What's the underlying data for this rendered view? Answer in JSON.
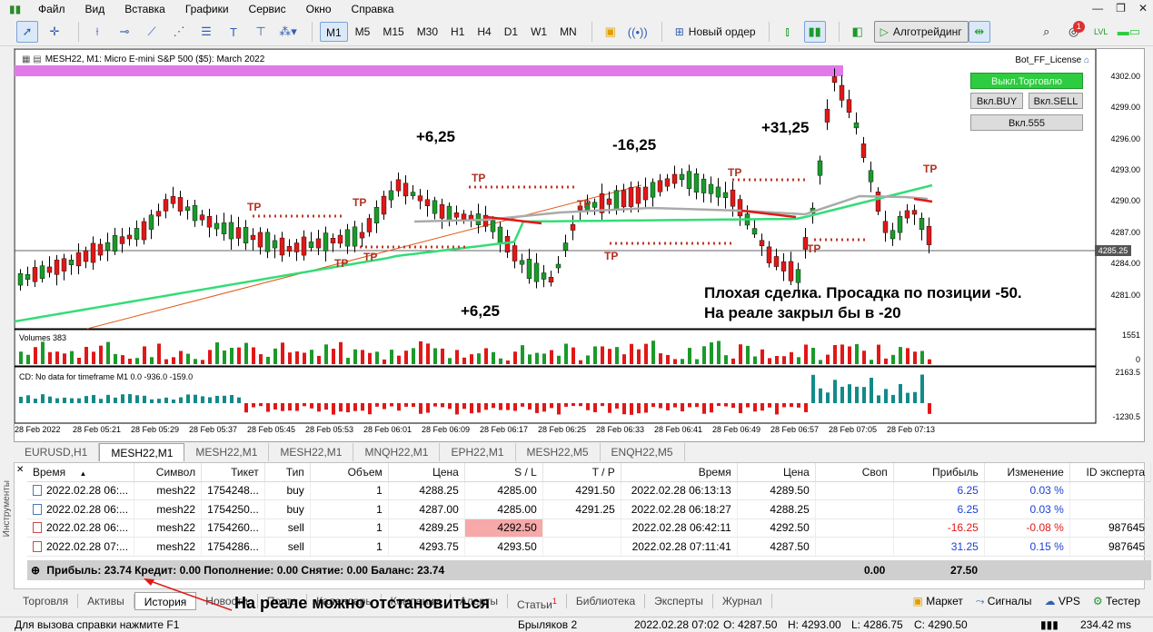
{
  "menu": [
    "Файл",
    "Вид",
    "Вставка",
    "Графики",
    "Сервис",
    "Окно",
    "Справка"
  ],
  "window_controls": [
    "—",
    "❐",
    "✕"
  ],
  "toolbar": {
    "timeframes": [
      "M1",
      "M5",
      "M15",
      "M30",
      "H1",
      "H4",
      "D1",
      "W1",
      "MN"
    ],
    "active_timeframe": "M1",
    "new_order": "Новый ордер",
    "algotrading": "Алготрейдинг",
    "notification_count": "1"
  },
  "chart": {
    "title": "MESH22, M1:  Micro E-mini S&P 500 ($5): March 2022",
    "bot_label": "Bot_FF_License",
    "buttons": {
      "trade_off": "Выкл.Торговлю",
      "buy_on": "Вкл.BUY",
      "sell_on": "Вкл.SELL",
      "on_555": "Вкл.555"
    },
    "price_labels": [
      "4302.00",
      "4299.00",
      "4296.00",
      "4293.00",
      "4290.00",
      "4287.00",
      "4284.00",
      "4281.00"
    ],
    "current_price": "4285.25",
    "tp_label": "TP",
    "annotations": {
      "a1": "+6,25",
      "a2": "-16,25",
      "a3": "+31,25",
      "a4": "+6,25",
      "note_line1": "Плохая сделка. Просадка по позиции -50.",
      "note_line2": "На реале закрыл бы в -20"
    },
    "volumes_label": "Volumes 383",
    "volumes_scale": [
      "1551",
      "0"
    ],
    "cd_label": "CD: No data for timeframe M1 0.0 -936.0 -159.0",
    "cd_scale": [
      "2163.5",
      "-1230.5"
    ],
    "time_labels": [
      "28 Feb 2022",
      "28 Feb 05:21",
      "28 Feb 05:29",
      "28 Feb 05:37",
      "28 Feb 05:45",
      "28 Feb 05:53",
      "28 Feb 06:01",
      "28 Feb 06:09",
      "28 Feb 06:17",
      "28 Feb 06:25",
      "28 Feb 06:33",
      "28 Feb 06:41",
      "28 Feb 06:49",
      "28 Feb 06:57",
      "28 Feb 07:05",
      "28 Feb 07:13"
    ],
    "colors": {
      "bull": "#1a9a2a",
      "bear": "#e01818",
      "ma": "#33dd77",
      "band": "#e07ae8"
    }
  },
  "chart_tabs": [
    "EURUSD,H1",
    "MESH22,M1",
    "MESH22,M1",
    "MESH22,M1",
    "MNQH22,M1",
    "EPH22,M1",
    "MESH22,M5",
    "ENQH22,M5"
  ],
  "active_chart_tab": 1,
  "table": {
    "headers": [
      "Время",
      "Символ",
      "Тикет",
      "Тип",
      "Объем",
      "Цена",
      "S / L",
      "T / P",
      "Время",
      "Цена",
      "Своп",
      "Прибыль",
      "Изменение",
      "ID эксперта"
    ],
    "rows": [
      {
        "type_icon": "buy",
        "time": "2022.02.28 06:...",
        "symbol": "mesh22",
        "ticket": "1754248...",
        "type": "buy",
        "volume": "1",
        "price": "4288.25",
        "sl": "4285.00",
        "tp": "4291.50",
        "close_time": "2022.02.28 06:13:13",
        "close_price": "4289.50",
        "swap": "",
        "profit": "6.25",
        "change": "0.03 %",
        "expert": ""
      },
      {
        "type_icon": "buy",
        "time": "2022.02.28 06:...",
        "symbol": "mesh22",
        "ticket": "1754250...",
        "type": "buy",
        "volume": "1",
        "price": "4287.00",
        "sl": "4285.00",
        "tp": "4291.25",
        "close_time": "2022.02.28 06:18:27",
        "close_price": "4288.25",
        "swap": "",
        "profit": "6.25",
        "change": "0.03 %",
        "expert": ""
      },
      {
        "type_icon": "sell",
        "time": "2022.02.28 06:...",
        "symbol": "mesh22",
        "ticket": "1754260...",
        "type": "sell",
        "volume": "1",
        "price": "4289.25",
        "sl": "4292.50",
        "tp": "",
        "close_time": "2022.02.28 06:42:11",
        "close_price": "4292.50",
        "swap": "",
        "profit": "-16.25",
        "change": "-0.08 %",
        "expert": "987645"
      },
      {
        "type_icon": "sell",
        "time": "2022.02.28 07:...",
        "symbol": "mesh22",
        "ticket": "1754286...",
        "type": "sell",
        "volume": "1",
        "price": "4293.75",
        "sl": "4293.50",
        "tp": "",
        "close_time": "2022.02.28 07:11:41",
        "close_price": "4287.50",
        "swap": "",
        "profit": "31.25",
        "change": "0.15 %",
        "expert": "987645"
      }
    ],
    "summary": "Прибыль: 23.74  Кредит: 0.00  Пополнение: 0.00  Снятие: 0.00  Баланс: 23.74",
    "summary_swap": "0.00",
    "summary_profit": "27.50"
  },
  "side_label": "Инструменты",
  "bottom_tabs": [
    "Торговля",
    "Активы",
    "История",
    "Новости",
    "Почта",
    "Календарь",
    "Компании",
    "Алерты",
    "Статьи",
    "Библиотека",
    "Эксперты",
    "Журнал"
  ],
  "articles_badge": "1",
  "active_bottom_tab": "История",
  "right_buttons": [
    "Маркет",
    "Сигналы",
    "VPS",
    "Тестер"
  ],
  "red_message": "На реале можно отстановиться",
  "status": {
    "help": "Для вызова справки нажмите F1",
    "profile": "Брыляков 2",
    "datetime": "2022.02.28 07:02",
    "open": "O: 4287.50",
    "high": "H: 4293.00",
    "low": "L: 4286.75",
    "close": "C: 4290.50",
    "ping": "234.42 ms"
  }
}
